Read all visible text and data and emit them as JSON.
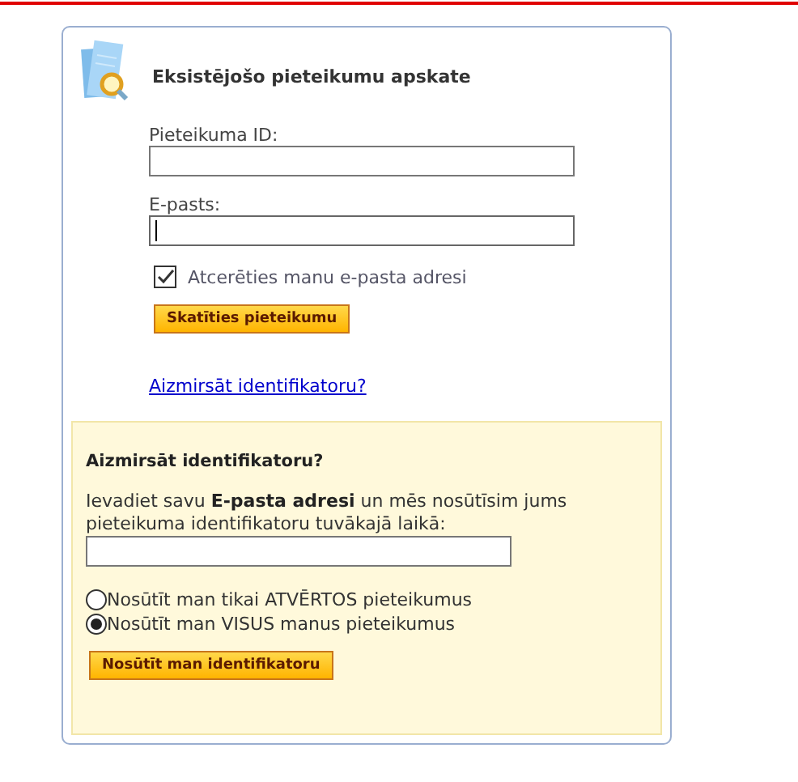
{
  "title": "Eksistējošo pieteikumu apskate",
  "id_field": {
    "label": "Pieteikuma ID:"
  },
  "email_field": {
    "label": "E-pasts:",
    "focused": true
  },
  "remember": {
    "label": "Atcerēties manu e-pasta adresi",
    "checked": true
  },
  "view_button": "Skatīties pieteikumu",
  "forgot_link": "Aizmirsāt identifikatoru?",
  "forgot_panel": {
    "title": "Aizmirsāt identifikatoru?",
    "text": "Ievadiet savu **E-pasta adresi** un mēs nosūtīsim jums pieteikuma identifikatoru tuvākajā laikā:",
    "options": [
      {
        "label": "Nosūtīt man tikai ATVĒRTOS pieteikumus",
        "selected": false
      },
      {
        "label": "Nosūtīt man VISUS manus pieteikumus",
        "selected": true
      }
    ],
    "button": "Nosūtīt man identifikatoru"
  }
}
